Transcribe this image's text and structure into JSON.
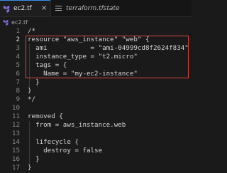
{
  "tabs": [
    {
      "label": "ec2.tf",
      "close_glyph": "×",
      "active": true
    },
    {
      "label": "terraform.tfstate",
      "active": false
    }
  ],
  "breadcrumb": {
    "label": "ec2.tf"
  },
  "editor": {
    "lines": [
      {
        "number": "1",
        "text": "/*"
      },
      {
        "number": "2",
        "text": "resource \"aws_instance\" \"web\" {"
      },
      {
        "number": "3",
        "text": "  ami           = \"ami-04999cd8f2624f834\""
      },
      {
        "number": "4",
        "text": "  instance_type = \"t2.micro\""
      },
      {
        "number": "5",
        "text": "  tags = {"
      },
      {
        "number": "6",
        "text": "    Name = \"my-ec2-instance\""
      },
      {
        "number": "7",
        "text": "  }"
      },
      {
        "number": "8",
        "text": "}"
      },
      {
        "number": "9",
        "text": "*/"
      },
      {
        "number": "10",
        "text": ""
      },
      {
        "number": "11",
        "text": "removed {"
      },
      {
        "number": "12",
        "text": "  from = aws_instance.web"
      },
      {
        "number": "13",
        "text": ""
      },
      {
        "number": "14",
        "text": "  lifecycle {"
      },
      {
        "number": "15",
        "text": "    destroy = false"
      },
      {
        "number": "16",
        "text": "  }"
      },
      {
        "number": "17",
        "text": "}"
      }
    ]
  },
  "colors": {
    "highlight_border": "#d9463a",
    "active_tab_accent": "#3a8ee6",
    "terraform_icon": "#8a6fe8"
  }
}
